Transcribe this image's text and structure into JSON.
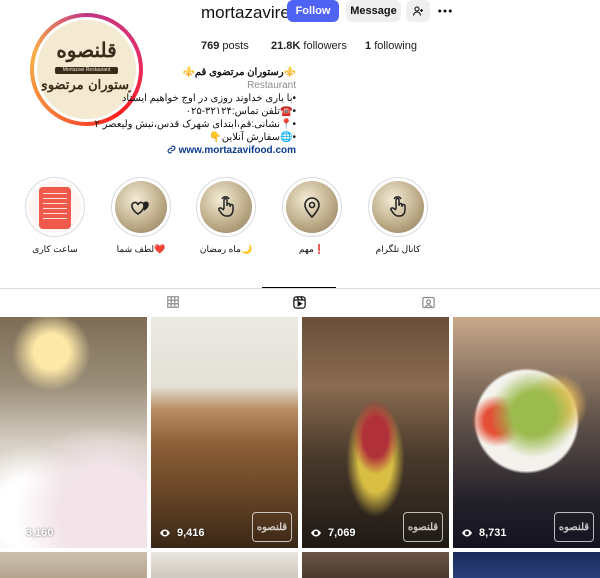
{
  "profile": {
    "username": "mortazavires",
    "avatar_logo_top": "قلنصوه",
    "avatar_logo_band": "Mortazavi Restaurant",
    "avatar_logo_bottom": "رستوران مرتضوی",
    "buttons": {
      "follow": "Follow",
      "message": "Message"
    },
    "stats": {
      "posts_count": "769",
      "posts_label": "posts",
      "followers_count": "21.8K",
      "followers_label": "followers",
      "following_count": "1",
      "following_label": "following"
    },
    "bio": {
      "name": "⚜️رستوران مرتضوی قم⚜️",
      "category": "Restaurant",
      "line1": "•با یاری خداوند روزی در اوج خواهیم ایستاد",
      "line2": "•☎️تلفن تماس:۳۲۱۲۴-۰۲۵",
      "line3": "•📍نشانی:قم،ابتدای شهرک قدس،نبش ولیعصر ۲",
      "line4": "•🌐سفارش آنلاین👇",
      "link": "www.mortazavifood.com"
    }
  },
  "highlights": [
    {
      "label": "ساعت کاری",
      "icon": "menu-card"
    },
    {
      "label": "لطف شما❤️",
      "icon": "hearts-icon"
    },
    {
      "label": "ماه رمضان🌙",
      "icon": "tap-hand-icon"
    },
    {
      "label": "مهم❗",
      "icon": "location-pin-icon"
    },
    {
      "label": "کانال تلگرام",
      "icon": "tap-hand-icon"
    }
  ],
  "tabs": [
    "posts-grid-icon",
    "reels-icon",
    "tagged-icon"
  ],
  "posts": [
    {
      "views": "3,160"
    },
    {
      "views": "9,416"
    },
    {
      "views": "7,069"
    },
    {
      "views": "8,731"
    }
  ],
  "watermark_text": "قلنصوه",
  "colors": {
    "accent": "#4f63f5",
    "link": "#0b3b8f"
  }
}
